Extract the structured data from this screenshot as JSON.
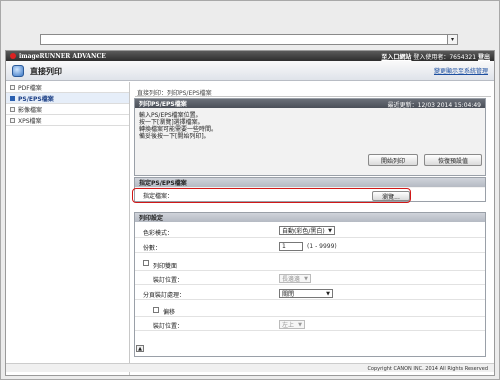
{
  "browser": {
    "address_value": ""
  },
  "brand": {
    "title": "imageRUNNER ADVANCE",
    "portal_link": "至入口網站",
    "user_label": "登入使用者：7654321",
    "logout_link": "登出"
  },
  "header": {
    "title": "直接列印",
    "right_link": "變更顯示至系統管理"
  },
  "sidebar": {
    "items": [
      {
        "label": "PDF檔案"
      },
      {
        "label": "PS/EPS檔案"
      },
      {
        "label": "影像檔案"
      },
      {
        "label": "XPS檔案"
      }
    ]
  },
  "breadcrumb": "直接列印：列印PS/EPS檔案",
  "print_panel": {
    "title": "列印PS/EPS檔案",
    "last_updated": "最近更新：12/03 2014 15:04:49",
    "info_lines": [
      "輸入PS/EPS檔案位置。",
      "按一下[瀏覽]選擇檔案。",
      "轉換檔案可能需要一些時間。",
      "備妥後按一下[開始列印]。"
    ],
    "start_button": "開始列印",
    "restore_button": "恢復預設值"
  },
  "file_panel": {
    "title": "指定PS/EPS檔案",
    "file_label": "指定檔案：",
    "browse_button": "瀏覽..."
  },
  "settings_panel": {
    "title": "列印設定",
    "color_mode_label": "色彩模式：",
    "color_mode_value": "自動(彩色/黑白)",
    "copies_label": "份數：",
    "copies_value": "1",
    "copies_range": "(1 - 9999)",
    "duplex_label": "列印雙面",
    "binding_label": "裝訂位置：",
    "binding_value": "長邊邊",
    "finishing_label": "分頁裝訂處理：",
    "finishing_value": "關閉",
    "offset_label": "偏移",
    "staple_label": "裝訂位置：",
    "staple_value": "左上"
  },
  "footer": {
    "copyright": "Copyright CANON INC. 2014 All Rights Reserved"
  }
}
